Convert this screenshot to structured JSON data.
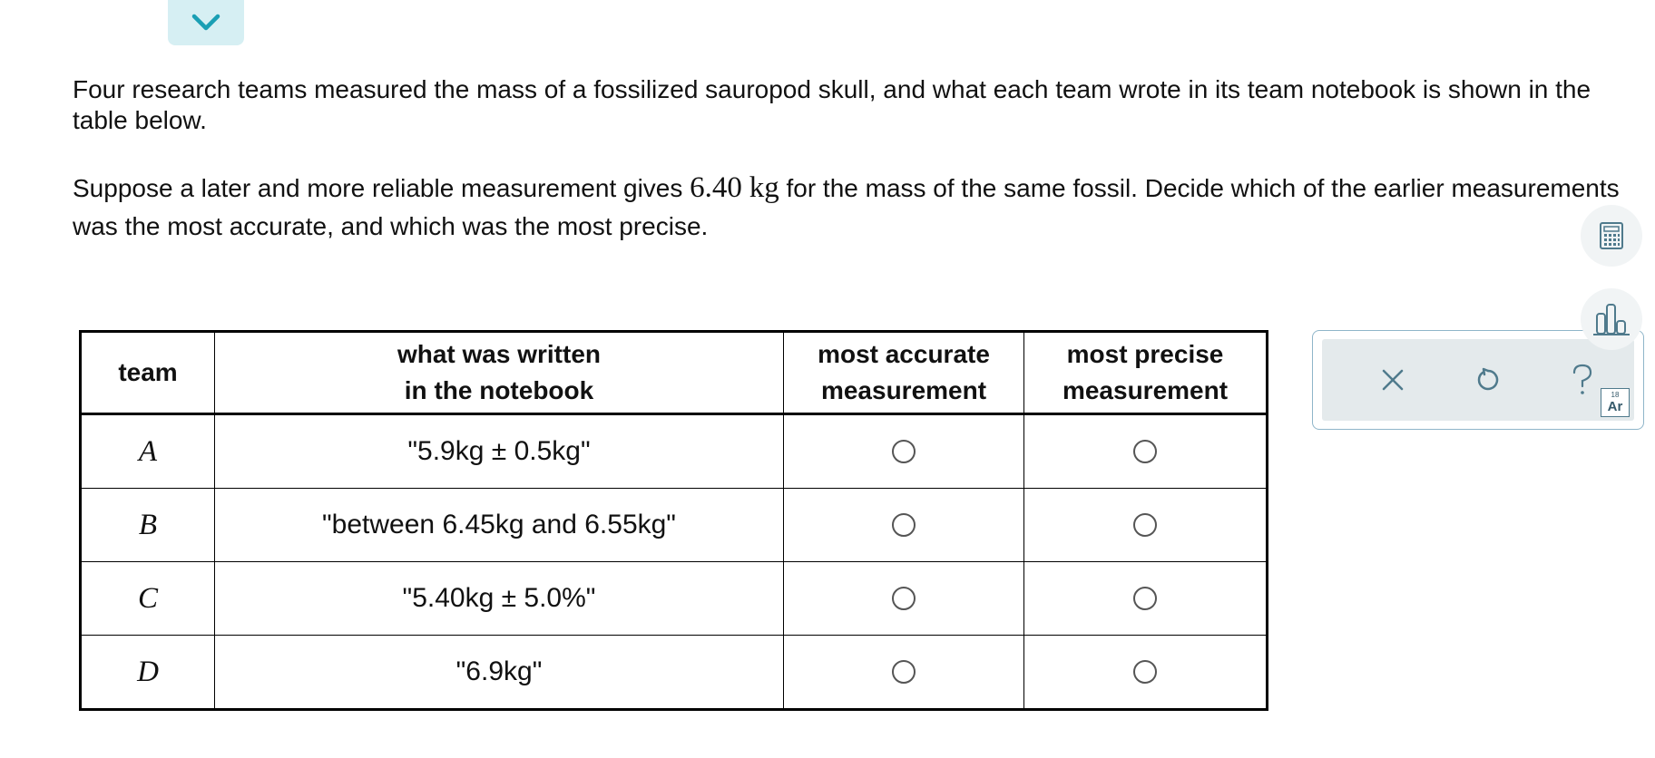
{
  "problem": {
    "para1": "Four research teams measured the mass of a fossilized sauropod skull, and what each team wrote in its team notebook is shown in the table below.",
    "para2_before": "Suppose a later and more reliable measurement gives ",
    "para2_value": "6.40",
    "para2_unit": "kg",
    "para2_after": " for the mass of the same fossil. Decide which of the earlier measurements was the most accurate, and which was the most precise."
  },
  "table": {
    "headers": {
      "team": "team",
      "notes_line1": "what was written",
      "notes_line2": "in the notebook",
      "accurate_line1": "most accurate",
      "accurate_line2": "measurement",
      "precise_line1": "most precise",
      "precise_line2": "measurement"
    },
    "rows": [
      {
        "team": "A",
        "note": "\"5.9kg ± 0.5kg\"",
        "accurate_selected": false,
        "precise_selected": false
      },
      {
        "team": "B",
        "note": "\"between 6.45kg and 6.55kg\"",
        "accurate_selected": false,
        "precise_selected": false
      },
      {
        "team": "C",
        "note": "\"5.40kg ± 5.0%\"",
        "accurate_selected": false,
        "precise_selected": false
      },
      {
        "team": "D",
        "note": "\"6.9kg\"",
        "accurate_selected": false,
        "precise_selected": false
      }
    ]
  },
  "answer_panel": {
    "icons": [
      "close-icon",
      "undo-icon",
      "help-icon"
    ]
  },
  "tools": {
    "icons": [
      "calculator-icon",
      "data-chart-icon",
      "periodic-table-icon"
    ],
    "periodic_number": "18",
    "periodic_symbol": "Ar"
  },
  "colors": {
    "accent": "#1a9fb4",
    "tab_bg": "#d6eff3",
    "panel_border": "#8fb5c9",
    "panel_bg": "#e4eaec",
    "icon": "#4f7a8c"
  }
}
